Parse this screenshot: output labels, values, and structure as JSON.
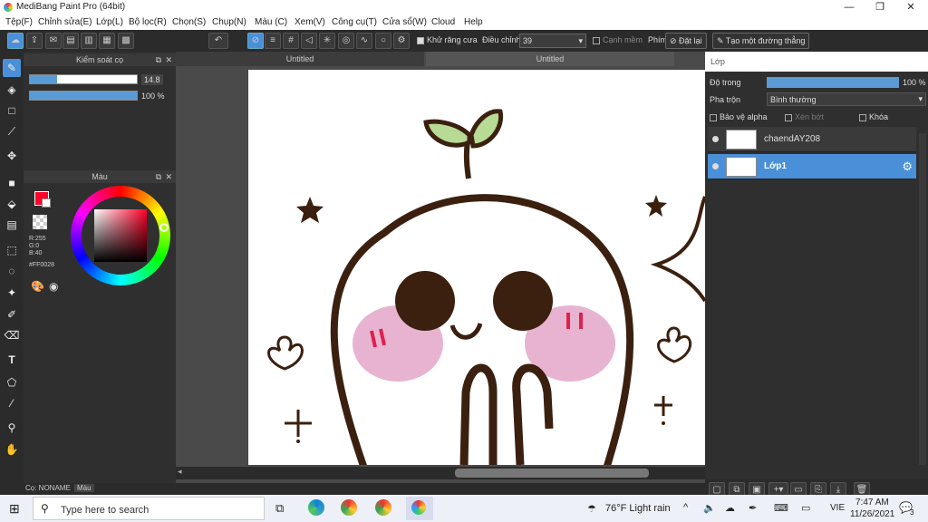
{
  "window": {
    "title": "MediBang Paint Pro (64bit)"
  },
  "menu": [
    "Tệp(F)",
    "Chỉnh sửa(E)",
    "Lớp(L)",
    "Bộ lọc(R)",
    "Chọn(S)",
    "Chụp(N)",
    "Màu (C)",
    "Xem(V)",
    "Công cụ(T)",
    "Cửa sổ(W)",
    "Cloud",
    "Help"
  ],
  "toolbar": {
    "antialias_label": "Khử răng cưa",
    "correction_label": "Điều chỉnh",
    "correction_value": "39",
    "soft_edge_label": "Cạnh mềm",
    "shortcut_label": "Phím",
    "reset_label": "Đặt lại",
    "straight_line_label": "Tạo một đường thẳng"
  },
  "brush_panel": {
    "title": "Kiểm soát cọ",
    "size_value": "14.8",
    "size_fraction": 0.25,
    "opacity_value": "100 %",
    "opacity_fraction": 1.0
  },
  "color_panel": {
    "title": "Màu",
    "r": "R:255",
    "g": "G:0",
    "b": "B:40",
    "hex": "#FF0028",
    "primary_color": "#ff0028"
  },
  "bottom_tabs": {
    "brush_tab": "Cọ: NONAME",
    "color_tab": "Màu"
  },
  "tabs": [
    "Untitled",
    "Untitled"
  ],
  "layer_panel": {
    "title": "Lớp",
    "opacity_label": "Độ trong",
    "opacity_value": "100 %",
    "blend_label": "Pha trộn",
    "blend_value": "Bình thường",
    "protect_alpha": "Bảo vệ alpha",
    "clipping": "Xén bớt",
    "lock": "Khóa",
    "layers": [
      {
        "name": "chaendAY208",
        "selected": false
      },
      {
        "name": "Lớp1",
        "selected": true
      }
    ]
  },
  "taskbar": {
    "search_placeholder": "Type here to search",
    "weather": "76°F  Light rain",
    "lang": "VIE",
    "time": "7:47 AM",
    "date": "11/26/2021",
    "notifications": "3"
  }
}
